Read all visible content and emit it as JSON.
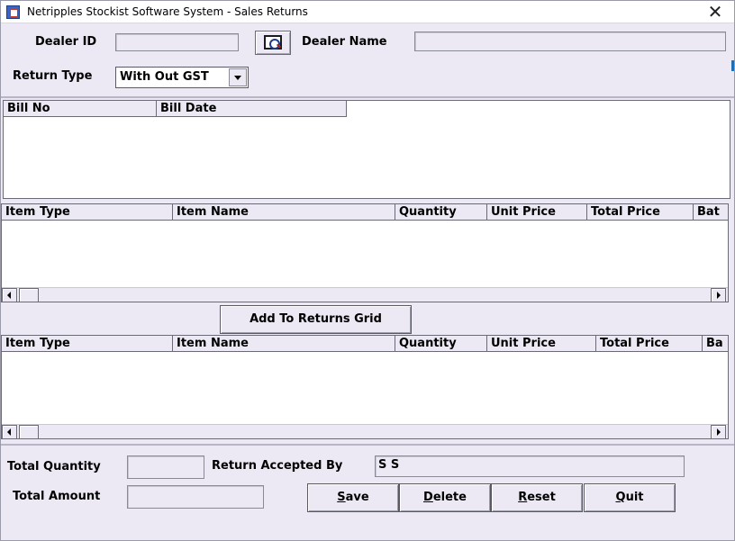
{
  "window": {
    "title": "Netripples Stockist Software System - Sales Returns",
    "close_label": "✕"
  },
  "dealer": {
    "id_label": "Dealer ID",
    "id_value": "",
    "name_label": "Dealer Name",
    "name_value": ""
  },
  "return_type": {
    "label": "Return Type",
    "selected": "With Out GST"
  },
  "bills_grid": {
    "columns": [
      "Bill No",
      "Bill Date"
    ]
  },
  "items_grid": {
    "columns": [
      "Item Type",
      "Item Name",
      "Quantity",
      "Unit Price",
      "Total Price",
      "Bat"
    ]
  },
  "add_button_label": "Add To Returns Grid",
  "returns_grid": {
    "columns": [
      "Item Type",
      "Item Name",
      "Quantity",
      "Unit Price",
      "Total Price",
      "Ba"
    ]
  },
  "footer": {
    "total_quantity_label": "Total Quantity",
    "total_quantity_value": "",
    "return_accepted_label": "Return Accepted By",
    "return_accepted_value": "S S",
    "total_amount_label": "Total Amount",
    "total_amount_value": ""
  },
  "buttons": {
    "save": {
      "first": "S",
      "rest": "ave"
    },
    "delete": {
      "first": "D",
      "rest": "elete"
    },
    "reset": {
      "first": "R",
      "rest": "eset"
    },
    "quit": {
      "first": "Q",
      "rest": "uit"
    }
  }
}
